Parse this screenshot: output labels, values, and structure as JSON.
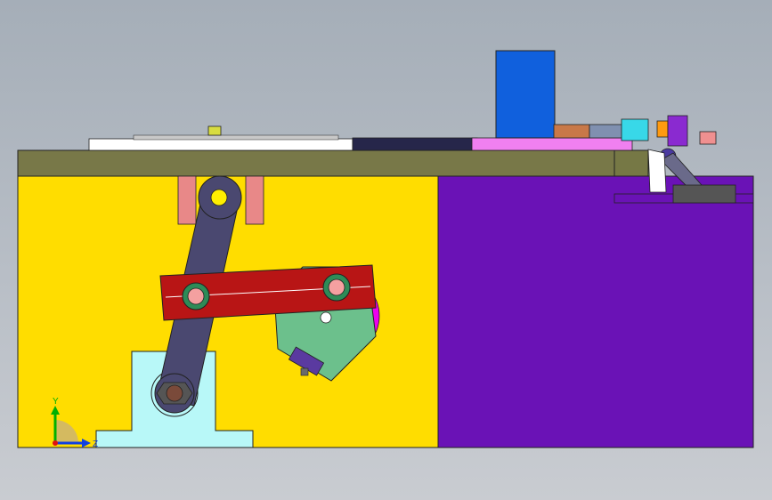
{
  "viewport": {
    "background_top": "#a5aeb8",
    "background_bottom": "#c9ccd1"
  },
  "colors": {
    "base_plate": "#787848",
    "left_block": "#ffdd00",
    "right_block": "#6a12b6",
    "motor": "#1060dd",
    "red_link": "#b81515",
    "dark_link": "#4a4870",
    "green_plate": "#6cc08c",
    "magenta": "#ee00ee",
    "pillow_block": "#b8f8f8",
    "pink_support": "#e88888",
    "rail": "#ffffff",
    "pink_slide": "#f080f0"
  },
  "triad": {
    "y_label": "Y",
    "z_label": "Z",
    "icon": "coordinate-triad-icon"
  }
}
